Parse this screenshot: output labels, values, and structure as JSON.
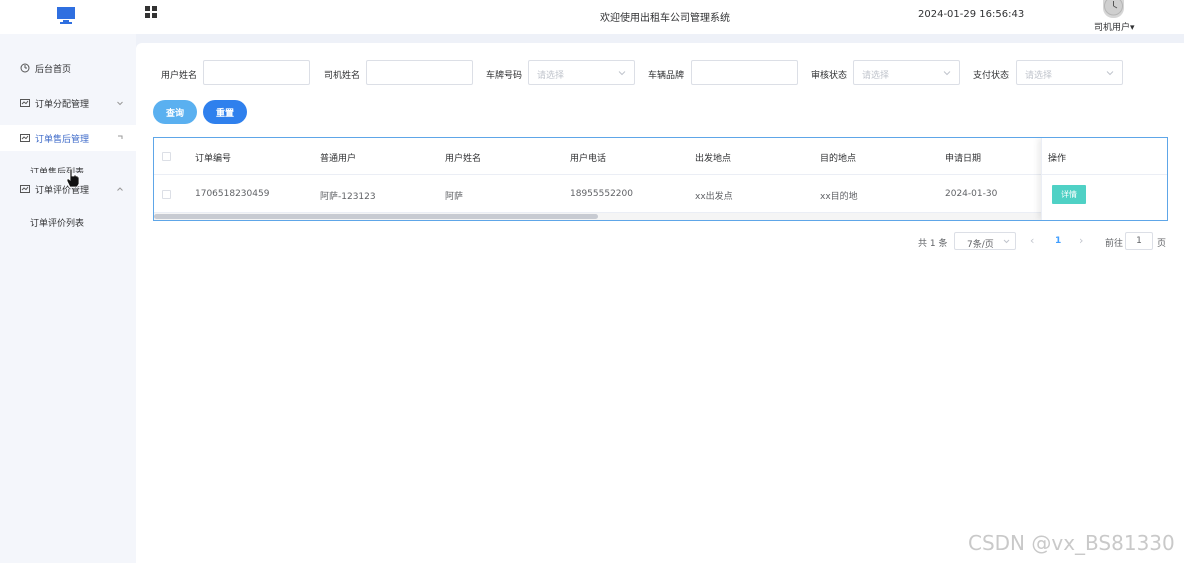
{
  "header": {
    "title": "欢迎使用出租车公司管理系统",
    "datetime": "2024-01-29 16:56:43",
    "user": "司机用户",
    "user_caret": "▾"
  },
  "sidebar": {
    "items": [
      {
        "label": "后台首页"
      },
      {
        "label": "订单分配管理"
      },
      {
        "label": "订单售后管理"
      },
      {
        "label": "订单评价管理"
      }
    ],
    "sub_items": [
      {
        "label": "订单售后列表"
      },
      {
        "label": "订单评价列表"
      }
    ]
  },
  "filters": {
    "user_name_label": "用户姓名",
    "user_name_value": "",
    "driver_name_label": "司机姓名",
    "driver_name_value": "",
    "plate_label": "车牌号码",
    "plate_placeholder": "请选择",
    "brand_label": "车辆品牌",
    "brand_value": "",
    "review_label": "审核状态",
    "review_placeholder": "请选择",
    "pay_label": "支付状态",
    "pay_placeholder": "请选择"
  },
  "buttons": {
    "search": "查询",
    "reset": "重置"
  },
  "table": {
    "headers": [
      "订单编号",
      "普通用户",
      "用户姓名",
      "用户电话",
      "出发地点",
      "目的地点",
      "申请日期",
      "操作"
    ],
    "rows": [
      {
        "order_no": "1706518230459",
        "user": "阿萨-123123",
        "name": "阿萨",
        "phone": "18955552200",
        "from": "xx出发点",
        "to": "xx目的地",
        "date": "2024-01-30",
        "action": "详情"
      }
    ]
  },
  "pagination": {
    "total": "共 1 条",
    "page_size": "7条/页",
    "prev": "‹",
    "current": "1",
    "next": "›",
    "goto_label": "前往",
    "goto_value": "1",
    "page_suffix": "页"
  },
  "watermark": "CSDN @vx_BS81330",
  "colors": {
    "accent": "#2f80ed",
    "search_button": "#5ab0f0",
    "detail_button": "#4fd1c5",
    "active_menu_text": "#3d6ac9"
  }
}
